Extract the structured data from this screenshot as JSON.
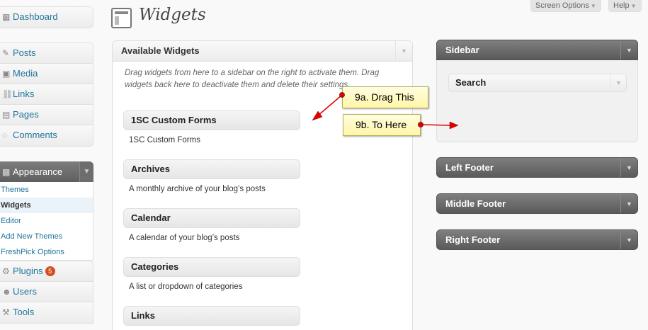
{
  "menu": {
    "top": [
      {
        "label": "Dashboard",
        "icon": "dashboard-icon"
      }
    ],
    "content": [
      {
        "label": "Posts",
        "icon": "pin-icon"
      },
      {
        "label": "Media",
        "icon": "media-icon"
      },
      {
        "label": "Links",
        "icon": "link-icon"
      },
      {
        "label": "Pages",
        "icon": "page-icon"
      },
      {
        "label": "Comments",
        "icon": "comment-icon"
      }
    ],
    "appearance": {
      "label": "Appearance",
      "icon": "appearance-icon",
      "items": [
        "Themes",
        "Widgets",
        "Editor",
        "Add New Themes",
        "FreshPick Options"
      ],
      "current": "Widgets"
    },
    "tools": [
      {
        "label": "Plugins",
        "icon": "plugin-icon",
        "badge": "5"
      },
      {
        "label": "Users",
        "icon": "users-icon"
      },
      {
        "label": "Tools",
        "icon": "tools-icon"
      }
    ]
  },
  "header": {
    "title": "Widgets",
    "screen_options": "Screen Options",
    "help": "Help"
  },
  "available": {
    "title": "Available Widgets",
    "description": "Drag widgets from here to a sidebar on the right to activate them. Drag widgets back here to deactivate them and delete their settings.",
    "widgets": [
      {
        "name": "1SC Custom Forms",
        "desc": "1SC Custom Forms"
      },
      {
        "name": "Archives",
        "desc": "A monthly archive of your blog’s posts"
      },
      {
        "name": "Calendar",
        "desc": "A calendar of your blog’s posts"
      },
      {
        "name": "Categories",
        "desc": "A list or dropdown of categories"
      },
      {
        "name": "Links",
        "desc": ""
      }
    ]
  },
  "callouts": {
    "drag": "9a. Drag This",
    "here": "9b. To Here"
  },
  "sidebars": {
    "main": {
      "title": "Sidebar",
      "widget": "Search"
    },
    "left_footer": "Left Footer",
    "middle_footer": "Middle Footer",
    "right_footer": "Right Footer"
  },
  "colors": {
    "link": "#21759b",
    "badge": "#d54e21",
    "arrow": "#e00000"
  }
}
